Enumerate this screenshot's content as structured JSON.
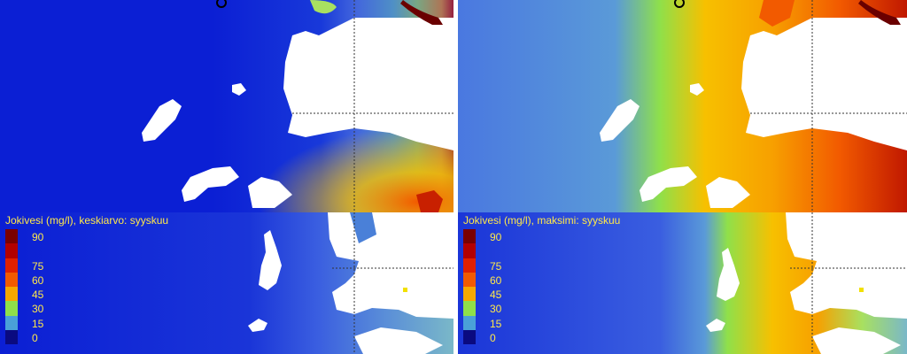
{
  "panels": {
    "left_bottom": {
      "legend_title": "Jokivesi (mg/l), keskiarvo: syyskuu"
    },
    "right_bottom": {
      "legend_title": "Jokivesi (mg/l), maksimi: syyskuu"
    }
  },
  "legend": {
    "items": [
      {
        "label": "90",
        "color": "#7a0000"
      },
      {
        "label": "",
        "color": "#b30000"
      },
      {
        "label": "75",
        "color": "#e02000"
      },
      {
        "label": "60",
        "color": "#f25a00"
      },
      {
        "label": "45",
        "color": "#f7a800"
      },
      {
        "label": "30",
        "color": "#8fe04a"
      },
      {
        "label": "15",
        "color": "#4aa0d8"
      },
      {
        "label": "0",
        "color": "#0a0a80"
      }
    ]
  },
  "colors": {
    "water_low": "#0a1fd0",
    "water_mid": "#4a78e0",
    "land": "#ffffff",
    "grid": "#333333",
    "legend_text": "#ffe94a"
  }
}
